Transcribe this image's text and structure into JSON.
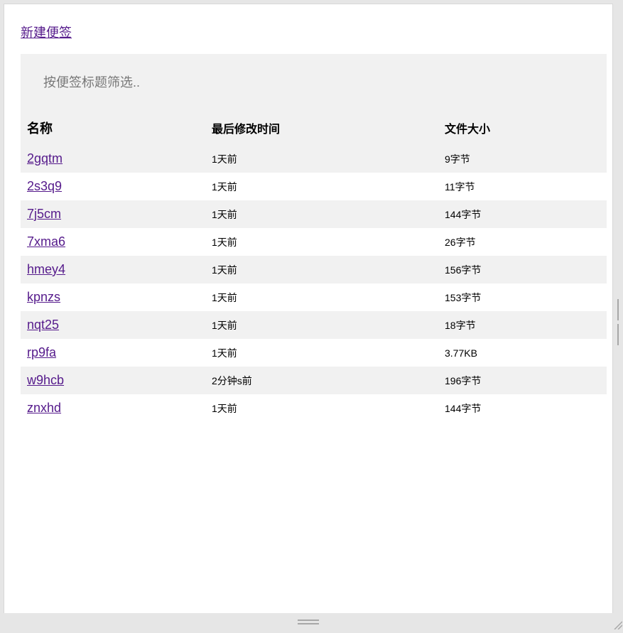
{
  "new_note_label": "新建便签",
  "filter": {
    "placeholder": "按便签标题筛选..",
    "value": ""
  },
  "table": {
    "headers": {
      "name": "名称",
      "modified": "最后修改时间",
      "size": "文件大小"
    },
    "rows": [
      {
        "name": "2gqtm",
        "modified": "1天前",
        "size": "9字节"
      },
      {
        "name": "2s3q9",
        "modified": "1天前",
        "size": "11字节"
      },
      {
        "name": "7j5cm",
        "modified": "1天前",
        "size": "144字节"
      },
      {
        "name": "7xma6",
        "modified": "1天前",
        "size": "26字节"
      },
      {
        "name": "hmey4",
        "modified": "1天前",
        "size": "156字节"
      },
      {
        "name": "kpnzs",
        "modified": "1天前",
        "size": "153字节"
      },
      {
        "name": "nqt25",
        "modified": "1天前",
        "size": "18字节"
      },
      {
        "name": "rp9fa",
        "modified": "1天前",
        "size": "3.77KB"
      },
      {
        "name": "w9hcb",
        "modified": "2分钟s前",
        "size": "196字节"
      },
      {
        "name": "znxhd",
        "modified": "1天前",
        "size": "144字节"
      }
    ]
  },
  "colors": {
    "link": "#551a8b",
    "stripe": "#f1f1f1",
    "frame_bg": "#e6e6e6"
  },
  "icons": {
    "bottom_handle": "horizontal-grip-icon",
    "side_handle": "vertical-grip-icon",
    "corner": "resize-corner-icon"
  }
}
